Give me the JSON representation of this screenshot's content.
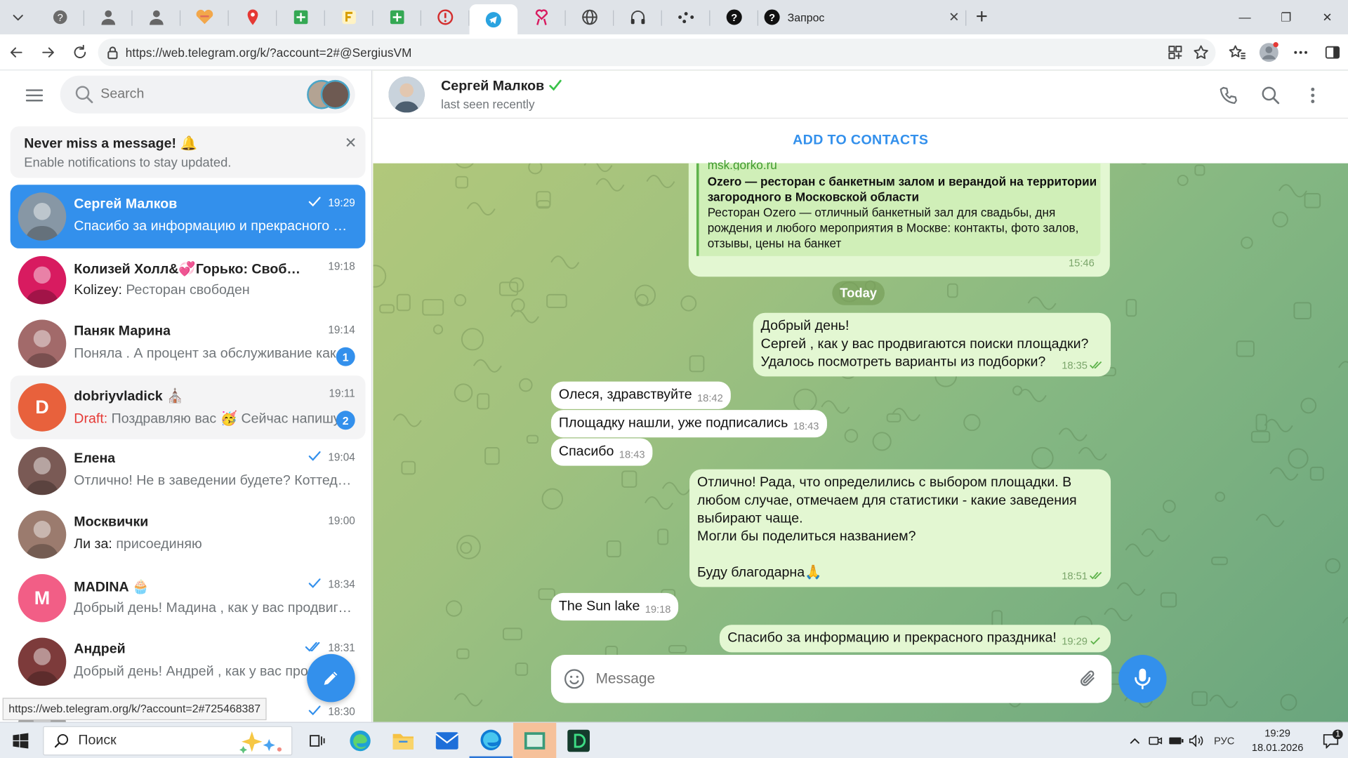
{
  "browser": {
    "active_tab_title": "Запрос",
    "new_tab": "+",
    "url": "https://web.telegram.org/k/?account=2#@SergiusVM",
    "status_url": "https://web.telegram.org/k/?account=2#725468387"
  },
  "sidebar": {
    "search_placeholder": "Search",
    "notice_title": "Never miss a message! 🔔",
    "notice_text": "Enable notifications to stay updated.",
    "notice_close": "✕",
    "chats": [
      {
        "name": "Сергей Малков",
        "time": "19:29",
        "preview": "Спасибо за информацию и прекрасного праздника!",
        "sender": "",
        "initial": "",
        "avatar_color": "#8797a5",
        "badge": "",
        "check": "single",
        "selected": true
      },
      {
        "name": "Колизей Холл&💞Горько: Свободные даты",
        "time": "19:18",
        "preview": "Ресторан свободен",
        "sender": "Kolizey: ",
        "initial": "",
        "avatar_color": "#d81b60",
        "badge": "",
        "check": "none"
      },
      {
        "name": "Паняк Марина",
        "time": "19:14",
        "preview": "Поняла . А процент за обслуживание какой?",
        "sender": "",
        "initial": "",
        "avatar_color": "#a26a6a",
        "badge": "1",
        "check": "none"
      },
      {
        "name": "dobriyvladick ⛪",
        "time": "19:11",
        "preview": "Поздравляю вас 🥳 Сейчас напишу",
        "sender": "Draft: ",
        "initial": "D",
        "avatar_color": "#e8613c",
        "badge": "2",
        "check": "none",
        "draft": true
      },
      {
        "name": "Елена",
        "time": "19:04",
        "preview": "Отлично! Не в заведении будете? Коттедж?",
        "sender": "",
        "initial": "",
        "avatar_color": "#7a5a55",
        "badge": "",
        "check": "single"
      },
      {
        "name": "Москвички",
        "time": "19:00",
        "preview": "присоединяю",
        "sender": "Ли за: ",
        "initial": "",
        "avatar_color": "#9b7b6e",
        "badge": "",
        "check": "none"
      },
      {
        "name": "MADINA 🧁",
        "time": "18:34",
        "preview": "Добрый день! Мадина , как у вас продвигаются поиски?",
        "sender": "",
        "initial": "M",
        "avatar_color": "#f25e86",
        "badge": "",
        "check": "single"
      },
      {
        "name": "Андрей",
        "time": "18:31",
        "preview": "Добрый день! Андрей , как у вас продвигаются поиски?",
        "sender": "",
        "initial": "",
        "avatar_color": "#7d3b3b",
        "badge": "",
        "check": "double"
      },
      {
        "name": "",
        "time": "18:30",
        "preview": "",
        "sender": "",
        "initial": "",
        "avatar_color": "#9a9a9a",
        "badge": "",
        "check": "single"
      }
    ]
  },
  "chat": {
    "peer_name": "Сергей Малков",
    "peer_status": "last seen recently",
    "add_contacts": "ADD TO CONTACTS",
    "date_chip": "Today",
    "composer_placeholder": "Message",
    "link_preview": {
      "site": "msk.gorko.ru",
      "title": "Ozero — ресторан с банкетным  залом и верандой на территории загородного в Московской области",
      "description": "Ресторан Ozero — отличный банкетный зал для свадьбы, дня рождения и любого мероприятия в Москве: контакты, фото залов, отзывы, цены на банкет",
      "time": "15:46"
    },
    "messages": [
      {
        "dir": "out",
        "lines": [
          "Добрый день!",
          "Сергей , как у вас продвигаются поиски площадки?",
          "Удалось посмотреть варианты из подборки?"
        ],
        "time": "18:35"
      },
      {
        "dir": "in",
        "lines": [
          "Олеся, здравствуйте"
        ],
        "time": "18:42"
      },
      {
        "dir": "in",
        "lines": [
          "Площадку нашли, уже подписались"
        ],
        "time": "18:43"
      },
      {
        "dir": "in",
        "lines": [
          "Спасибо"
        ],
        "time": "18:43"
      },
      {
        "dir": "out",
        "lines": [
          "Отлично! Рада, что определились с выбором площадки. В",
          "любом случае, отмечаем для статистики - какие заведения",
          "выбирают чаще.",
          "Могли бы поделиться названием?",
          "",
          "Буду благодарна🙏"
        ],
        "time": "18:51"
      },
      {
        "dir": "in",
        "lines": [
          "The Sun lake"
        ],
        "time": "19:18"
      },
      {
        "dir": "out",
        "lines": [
          "Спасибо за информацию и прекрасного праздника!"
        ],
        "time": "19:29"
      }
    ]
  },
  "taskbar": {
    "search_label": "Поиск",
    "lang": "РУС",
    "time": "19:29",
    "date": "18.01.2026",
    "notification_count": "1"
  },
  "colors": {
    "accent": "#3390ec",
    "outgoing": "#e3f7d2",
    "draft": "#e53935"
  }
}
